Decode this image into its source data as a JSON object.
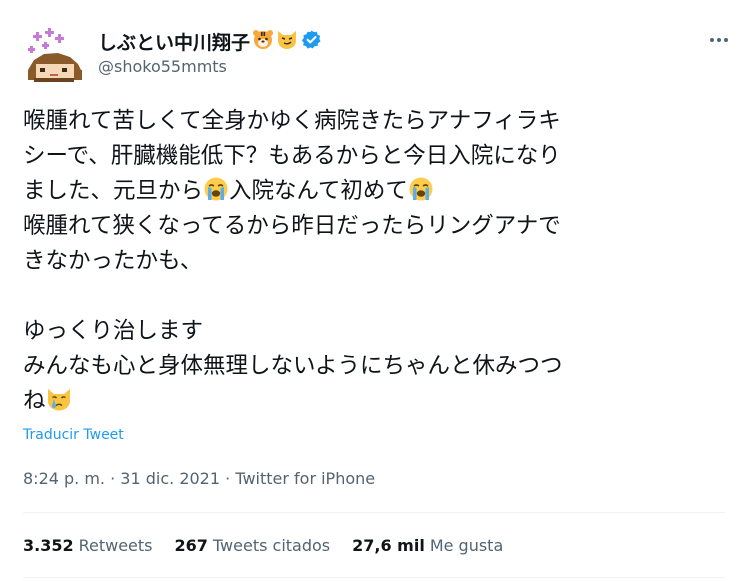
{
  "user": {
    "display_name": "しぶとい中川翔子",
    "handle": "@shoko55mmts",
    "verified": true,
    "name_emojis": [
      "tiger-face-icon",
      "smirking-cat-icon"
    ]
  },
  "tweet": {
    "lines": [
      {
        "text": "喉腫れて苦しくて全身かゆく病院きたらアナフィラキ"
      },
      {
        "text": "シーで、肝臓機能低下？もあるからと今日入院になり"
      },
      {
        "before": "ました、元旦から",
        "after": "入院なんて初めて",
        "emoji": "loudly-crying-face-icon"
      },
      {
        "text": "喉腫れて狭くなってるから昨日だったらリングアナで"
      },
      {
        "text": "きなかったかも、"
      },
      {
        "text": ""
      },
      {
        "text": "ゆっくり治します"
      },
      {
        "text": "みんなも心と身体無理しないようにちゃんと休みつつ"
      },
      {
        "before": "ね",
        "emoji": "crying-cat-icon"
      }
    ],
    "translate_label": "Traducir Tweet",
    "time": "8:24 p. m.",
    "date": "31 dic. 2021",
    "separator": "·",
    "source": "Twitter for iPhone"
  },
  "stats": {
    "retweets": {
      "value": "3.352",
      "label": "Retweets"
    },
    "quotes": {
      "value": "267",
      "label": "Tweets citados"
    },
    "likes": {
      "value": "27,6 mil",
      "label": "Me gusta"
    }
  },
  "colors": {
    "text": "#0f1419",
    "secondary": "#536471",
    "link": "#1d9bf0",
    "divider": "#eff3f4"
  }
}
